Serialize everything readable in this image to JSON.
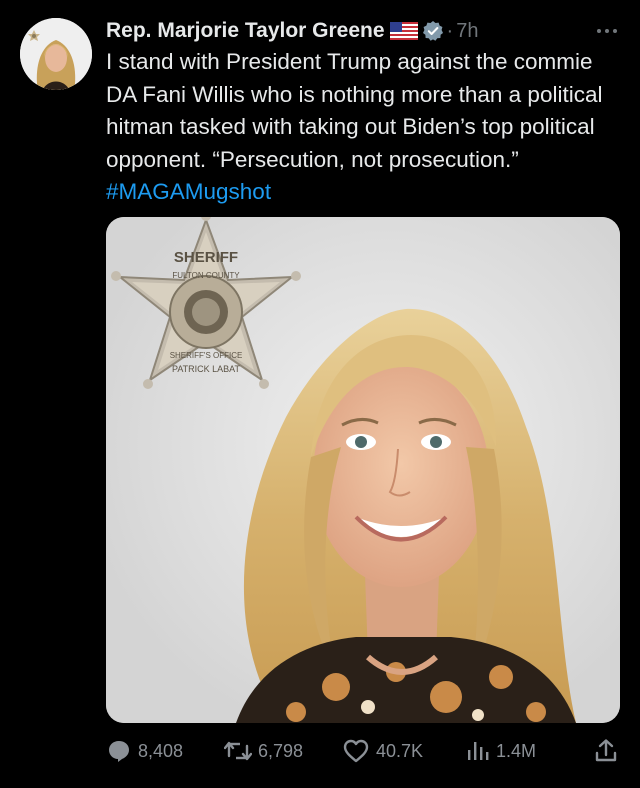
{
  "tweet": {
    "author_name": "Rep. Marjorie Taylor Greene",
    "dot": "·",
    "time": "7h",
    "text_main": "I stand with President Trump against the commie DA Fani Willis who is nothing more than a political hitman tasked with taking out Biden’s top political opponent. “Persecution, not prosecution.” ",
    "hashtag": "#MAGAMugshot",
    "media": {
      "badge_top": "SHERIFF",
      "badge_county": "FULTON COUNTY",
      "badge_office": "SHERIFF'S OFFICE",
      "badge_name": "PATRICK LABAT"
    }
  },
  "actions": {
    "replies": "8,408",
    "reposts": "6,798",
    "likes": "40.7K",
    "views": "1.4M"
  },
  "colors": {
    "background": "#000000",
    "text": "#e7e9ea",
    "secondary": "#71767b",
    "accent": "#1d9bf0"
  },
  "icons": [
    "flag-icon",
    "verified-icon",
    "more-icon",
    "reply-icon",
    "repost-icon",
    "like-icon",
    "views-icon",
    "share-icon"
  ]
}
